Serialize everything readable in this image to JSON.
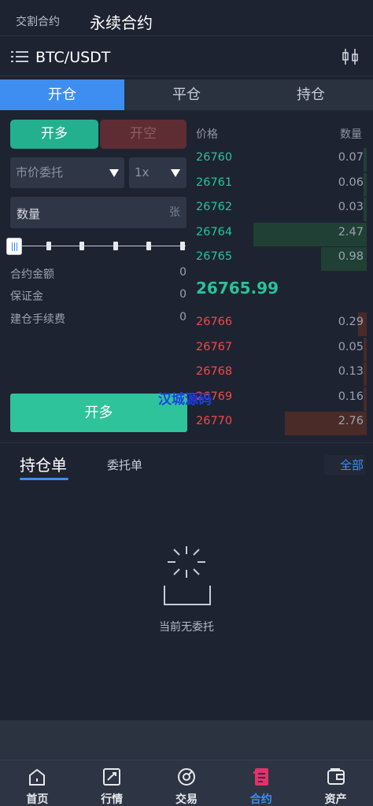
{
  "header": {
    "tab_inactive": "交割合约",
    "tab_active": "永续合约"
  },
  "pair": {
    "symbol": "BTC/USDT"
  },
  "trade_tabs": [
    "开仓",
    "平仓",
    "持仓"
  ],
  "side": {
    "long": "开多",
    "short": "开空"
  },
  "order_type": {
    "value": "市价委托"
  },
  "leverage": {
    "value": "1x"
  },
  "quantity": {
    "label": "数量",
    "unit": "张"
  },
  "slider": {
    "value_percent": 0
  },
  "info": [
    {
      "label": "合约金额",
      "value": "0"
    },
    {
      "label": "保证金",
      "value": "0"
    },
    {
      "label": "建仓手续费",
      "value": "0"
    }
  ],
  "submit_label": "开多",
  "orderbook": {
    "price_header": "价格",
    "qty_header": "数量",
    "buys": [
      {
        "price": "26760",
        "qty": "0.07",
        "depth": 0.02
      },
      {
        "price": "26761",
        "qty": "0.06",
        "depth": 0.02
      },
      {
        "price": "26762",
        "qty": "0.03",
        "depth": 0.02
      },
      {
        "price": "26764",
        "qty": "2.47",
        "depth": 0.65
      },
      {
        "price": "26765",
        "qty": "0.98",
        "depth": 0.26
      }
    ],
    "last_price": "26765.99",
    "sells": [
      {
        "price": "26766",
        "qty": "0.29",
        "depth": 0.05
      },
      {
        "price": "26767",
        "qty": "0.05",
        "depth": 0.02
      },
      {
        "price": "26768",
        "qty": "0.13",
        "depth": 0.02
      },
      {
        "price": "26769",
        "qty": "0.16",
        "depth": 0.02
      },
      {
        "price": "26770",
        "qty": "2.76",
        "depth": 0.47
      }
    ]
  },
  "watermark": "汉城源码",
  "orders": {
    "tab_positions": "持仓单",
    "tab_orders": "委托单",
    "all": "全部",
    "empty_text": "当前无委托"
  },
  "bottom_nav": [
    {
      "label": "首页",
      "icon": "home-icon"
    },
    {
      "label": "行情",
      "icon": "chart-icon"
    },
    {
      "label": "交易",
      "icon": "trade-icon"
    },
    {
      "label": "合约",
      "icon": "contract-icon",
      "active": true
    },
    {
      "label": "资产",
      "icon": "wallet-icon"
    }
  ],
  "colors": {
    "accent": "#3d8ef0",
    "buy": "#27c497",
    "sell": "#f04a4a",
    "background": "#1e2331"
  }
}
